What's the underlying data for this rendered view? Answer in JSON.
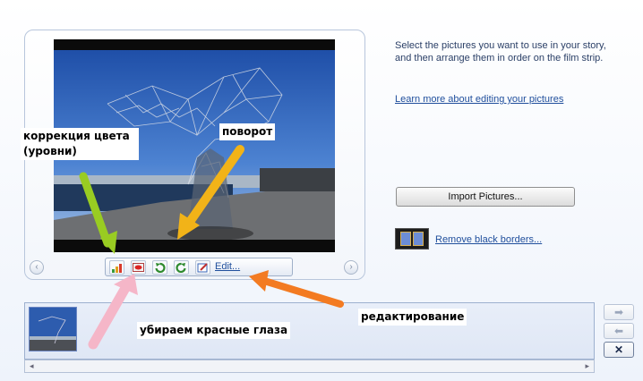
{
  "preview": {
    "edit_label": "Edit...",
    "tools": [
      {
        "icon": "color-levels-icon"
      },
      {
        "icon": "red-eye-icon"
      },
      {
        "icon": "rotate-left-icon"
      },
      {
        "icon": "rotate-right-icon"
      },
      {
        "icon": "edit-icon"
      }
    ]
  },
  "instructions": {
    "text": "Select the pictures you want to use in your story, and then arrange them in order on the film strip.",
    "learn_link": "Learn more about editing your pictures"
  },
  "actions": {
    "import_label": "Import Pictures...",
    "remove_label": "Remove black borders..."
  },
  "side_buttons": {
    "move_right": "➡",
    "move_left": "⬅",
    "remove": "✕"
  },
  "annotations": {
    "color_correction": "коррекция цвета (уровни)",
    "rotate": "поворот",
    "red_eye": "убираем красные глаза",
    "editing": "редактирование"
  },
  "colors": {
    "link": "#1f4e9c",
    "arrow_green": "#99cc22",
    "arrow_yellow": "#f2b318",
    "arrow_pink": "#f5b6c8",
    "arrow_orange": "#f37b22"
  }
}
